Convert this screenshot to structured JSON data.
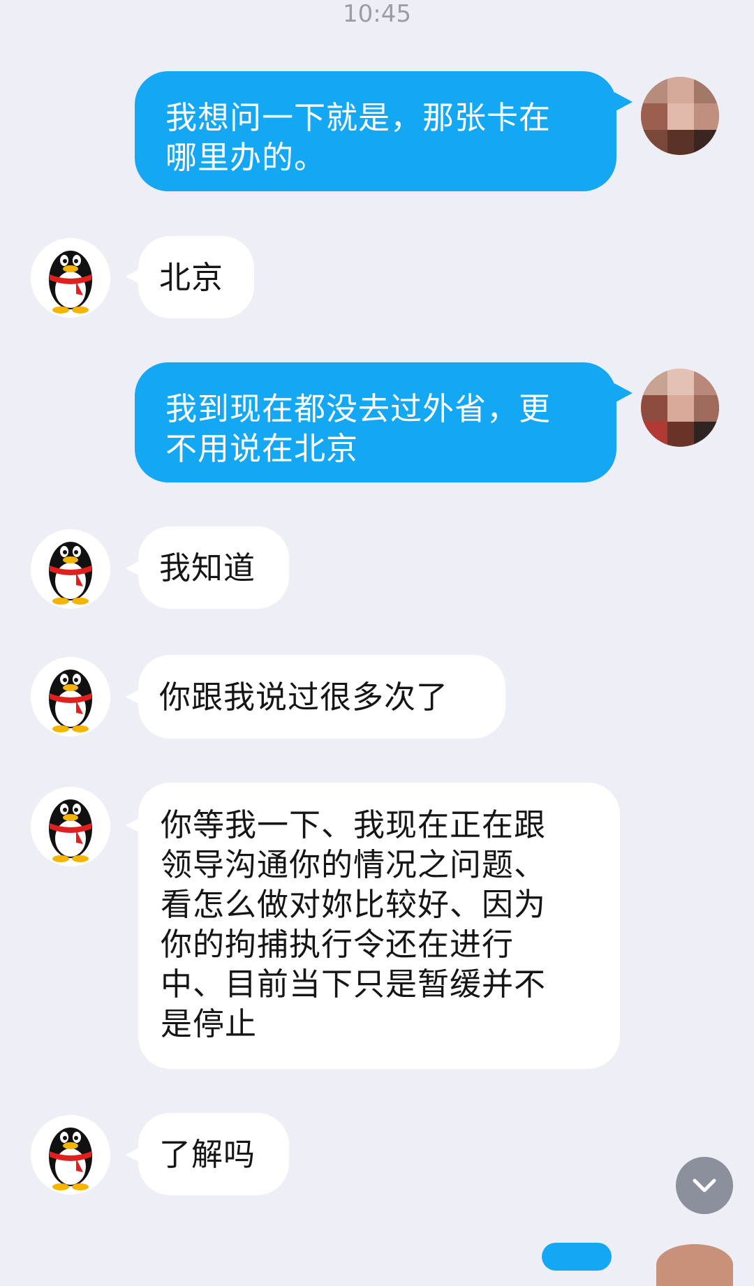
{
  "status": {
    "time": "10:45"
  },
  "messages": [
    {
      "side": "out",
      "text": "我想问一下就是，那张卡在\n哪里办的。"
    },
    {
      "side": "in",
      "text": "北京"
    },
    {
      "side": "out",
      "text": "我到现在都没去过外省，更\n不用说在北京"
    },
    {
      "side": "in",
      "text": "我知道"
    },
    {
      "side": "in",
      "text": "你跟我说过很多次了"
    },
    {
      "side": "in",
      "text": "你等我一下、我现在正在跟\n领导沟通你的情况之问题、\n看怎么做对妳比较好、因为\n你的拘捕执行令还在进行\n中、目前当下只是暂缓并不\n是停止"
    },
    {
      "side": "in",
      "text": "了解吗"
    }
  ],
  "icons": {
    "contact_avatar": "qq-penguin-icon",
    "user_avatar": "pixelated-user-photo",
    "scroll": "chevron-down-icon"
  },
  "colors": {
    "background": "#eeeff6",
    "outgoing_bubble": "#14a8f4",
    "incoming_bubble": "#ffffff",
    "scroll_button": "#8c8f9c"
  }
}
